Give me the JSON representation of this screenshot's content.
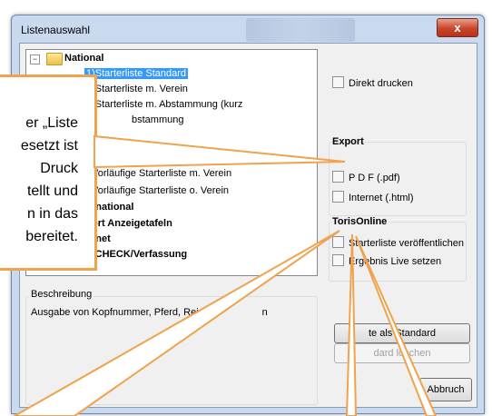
{
  "window": {
    "title": "Listenauswahl",
    "close_label": "x"
  },
  "tree": {
    "items": [
      {
        "label": "National",
        "bold": true
      },
      {
        "label": "1)Starterliste Standard",
        "selected": true
      },
      {
        "label": "2)Starterliste m. Verein"
      },
      {
        "label": "3)Starterliste m. Abstammung (kurz"
      },
      {
        "label": "bstammung"
      },
      {
        "label": "Vorläufige Starterliste m. Verein"
      },
      {
        "label": "Vorläufige Starterliste o. Verein"
      },
      {
        "label": "rnational",
        "bold": true
      },
      {
        "label": "ort Anzeigetafeln",
        "bold": true
      },
      {
        "label": "rnet",
        "bold": true
      },
      {
        "label": "-CHECK/Verfassung",
        "bold": true
      }
    ]
  },
  "options": {
    "direct_print": "Direkt drucken",
    "export_title": "Export",
    "pdf": "P D F (.pdf)",
    "internet": "Internet (.html)",
    "toris_title": "TorisOnline",
    "publish": "Starterliste veröffentlichen",
    "live": "Ergebnis Live setzen"
  },
  "description": {
    "label": "Beschreibung",
    "text": "Ausgabe von Kopfnummer, Pferd, Rei",
    "text_tail": "n"
  },
  "buttons": {
    "set_default": "te als Standard",
    "clear_default": "dard löschen",
    "cancel": "Abbruch"
  },
  "callout": {
    "lines": [
      "er „Liste",
      "esetzt ist",
      "Druck",
      "tellt und",
      "n in das",
      "bereitet."
    ]
  },
  "colors": {
    "callout_border": "#f0a24d",
    "selection": "#3399ff"
  }
}
